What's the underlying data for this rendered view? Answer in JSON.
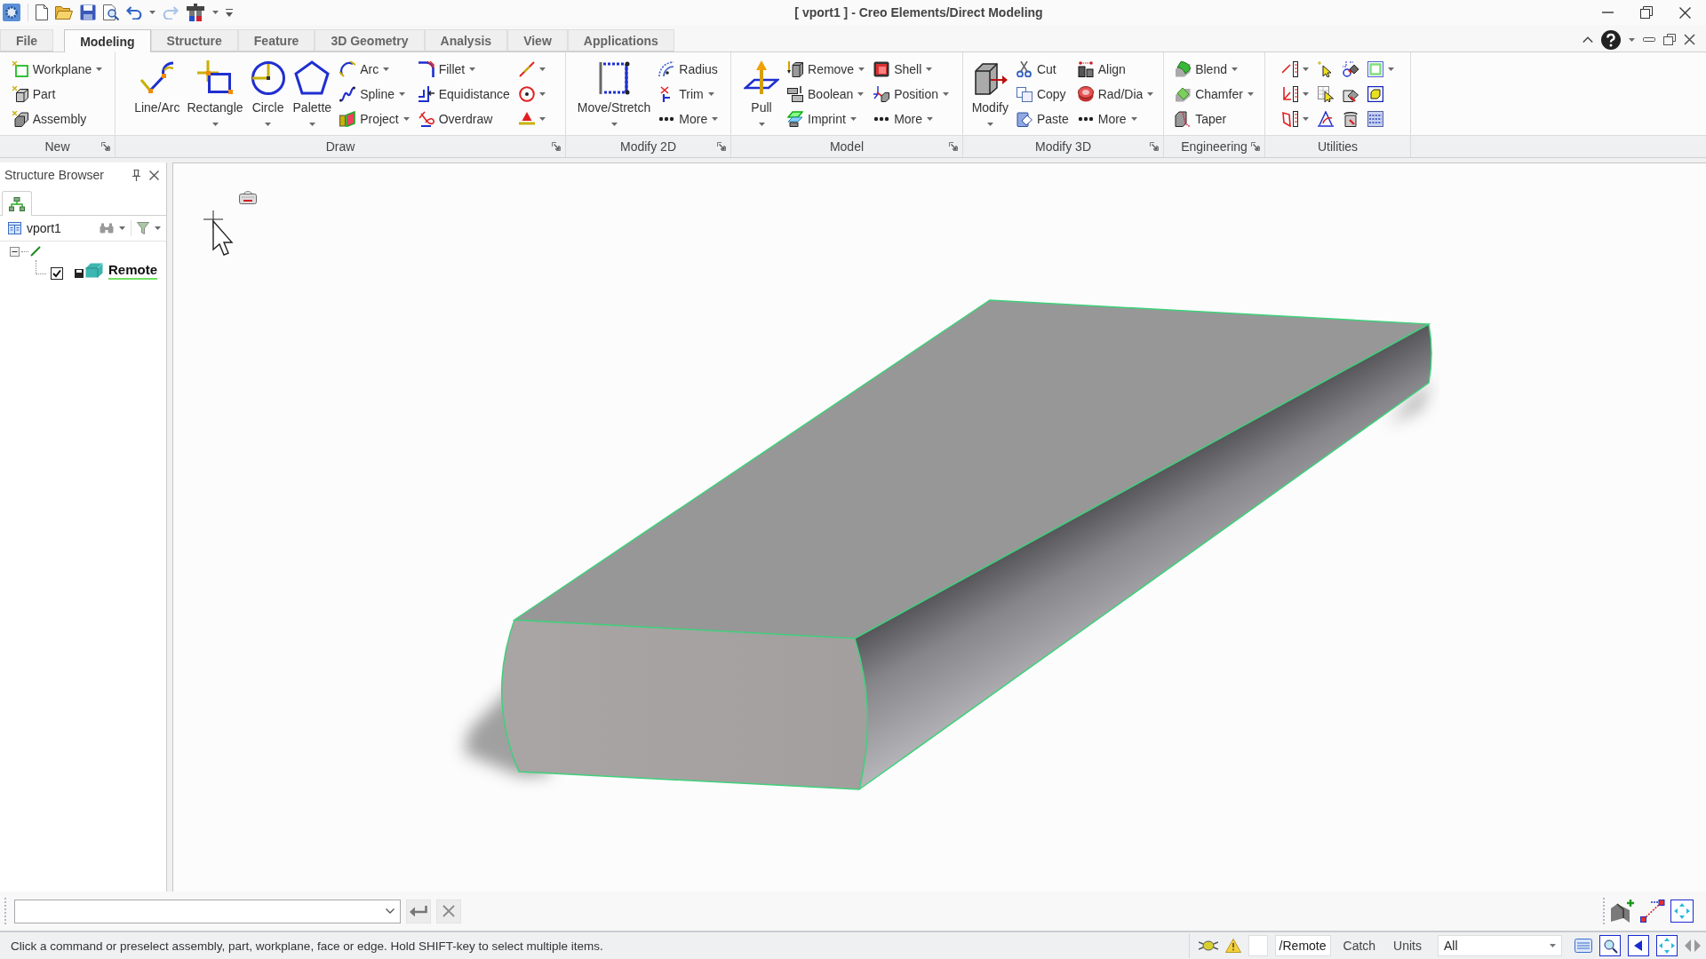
{
  "window": {
    "title": "[ vport1 ] - Creo Elements/Direct Modeling"
  },
  "tabs": [
    {
      "label": "File",
      "selected": false
    },
    {
      "label": "Modeling",
      "selected": true
    },
    {
      "label": "Structure",
      "selected": false
    },
    {
      "label": "Feature",
      "selected": false
    },
    {
      "label": "3D Geometry",
      "selected": false
    },
    {
      "label": "Analysis",
      "selected": false
    },
    {
      "label": "View",
      "selected": false
    },
    {
      "label": "Applications",
      "selected": false
    }
  ],
  "ribbon": {
    "groups": [
      {
        "label": "New",
        "launcher": true,
        "columns": [
          [
            {
              "kind": "small",
              "label": "Workplane",
              "dropdown": true
            },
            {
              "kind": "small",
              "label": "Part",
              "dropdown": false
            },
            {
              "kind": "small",
              "label": "Assembly",
              "dropdown": false
            }
          ]
        ]
      },
      {
        "label": "Draw",
        "launcher": true,
        "columns": [
          [
            {
              "kind": "large",
              "label": "Line/Arc",
              "dropdown": false
            }
          ],
          [
            {
              "kind": "large",
              "label": "Rectangle",
              "dropdown": true
            }
          ],
          [
            {
              "kind": "large",
              "label": "Circle",
              "dropdown": true
            }
          ],
          [
            {
              "kind": "large",
              "label": "Palette",
              "dropdown": true
            }
          ],
          [
            {
              "kind": "small",
              "label": "Arc",
              "dropdown": true
            },
            {
              "kind": "small",
              "label": "Spline",
              "dropdown": true
            },
            {
              "kind": "small",
              "label": "Project",
              "dropdown": true
            }
          ],
          [
            {
              "kind": "small",
              "label": "Fillet",
              "dropdown": true
            },
            {
              "kind": "small",
              "label": "Equidistance",
              "dropdown": false
            },
            {
              "kind": "small",
              "label": "Overdraw",
              "dropdown": false
            }
          ],
          [
            {
              "kind": "icon",
              "dropdown": true
            },
            {
              "kind": "icon",
              "dropdown": true
            },
            {
              "kind": "icon",
              "dropdown": true
            }
          ]
        ]
      },
      {
        "label": "Modify 2D",
        "launcher": true,
        "columns": [
          [
            {
              "kind": "large",
              "label": "Move/Stretch",
              "dropdown": true
            }
          ],
          [
            {
              "kind": "small",
              "label": "Radius",
              "dropdown": false
            },
            {
              "kind": "small",
              "label": "Trim",
              "dropdown": true
            },
            {
              "kind": "small",
              "label": "More",
              "dropdown": true
            }
          ]
        ]
      },
      {
        "label": "Model",
        "launcher": true,
        "columns": [
          [
            {
              "kind": "large",
              "label": "Pull",
              "dropdown": true
            }
          ],
          [
            {
              "kind": "small",
              "label": "Remove",
              "dropdown": true
            },
            {
              "kind": "small",
              "label": "Boolean",
              "dropdown": true
            },
            {
              "kind": "small",
              "label": "Imprint",
              "dropdown": true
            }
          ],
          [
            {
              "kind": "small",
              "label": "Shell",
              "dropdown": true
            },
            {
              "kind": "small",
              "label": "Position",
              "dropdown": true
            },
            {
              "kind": "small",
              "label": "More",
              "dropdown": true
            }
          ]
        ]
      },
      {
        "label": "Modify 3D",
        "launcher": true,
        "columns": [
          [
            {
              "kind": "large",
              "label": "Modify",
              "dropdown": true
            }
          ],
          [
            {
              "kind": "small",
              "label": "Cut",
              "dropdown": false
            },
            {
              "kind": "small",
              "label": "Copy",
              "dropdown": false
            },
            {
              "kind": "small",
              "label": "Paste",
              "dropdown": false
            }
          ],
          [
            {
              "kind": "small",
              "label": "Align",
              "dropdown": false
            },
            {
              "kind": "small",
              "label": "Rad/Dia",
              "dropdown": true
            },
            {
              "kind": "small",
              "label": "More",
              "dropdown": true
            }
          ]
        ]
      },
      {
        "label": "Engineering",
        "launcher": true,
        "columns": [
          [
            {
              "kind": "small",
              "label": "Blend",
              "dropdown": true
            },
            {
              "kind": "small",
              "label": "Chamfer",
              "dropdown": true
            },
            {
              "kind": "small",
              "label": "Taper",
              "dropdown": false
            }
          ]
        ]
      },
      {
        "label": "Utilities",
        "launcher": false,
        "columns": [
          [
            {
              "kind": "icon",
              "dropdown": true
            },
            {
              "kind": "icon",
              "dropdown": true
            },
            {
              "kind": "icon",
              "dropdown": true
            }
          ],
          [
            {
              "kind": "icon",
              "dropdown": false
            },
            {
              "kind": "icon",
              "dropdown": false
            },
            {
              "kind": "icon",
              "dropdown": false
            }
          ],
          [
            {
              "kind": "icon",
              "dropdown": false
            },
            {
              "kind": "icon",
              "dropdown": false
            },
            {
              "kind": "icon",
              "dropdown": false
            }
          ],
          [
            {
              "kind": "icon",
              "dropdown": true
            },
            {
              "kind": "icon",
              "dropdown": false
            },
            {
              "kind": "icon",
              "dropdown": false
            }
          ]
        ]
      }
    ]
  },
  "structure_browser": {
    "title": "Structure Browser",
    "root": "vport1",
    "tree": [
      {
        "expanded": true,
        "children": [
          {
            "label": "Remote",
            "checked": true,
            "active": true
          }
        ]
      }
    ]
  },
  "status_bar": {
    "message": "Click a command or preselect assembly, part, workplane, face or edge. Hold SHIFT-key to select multiple items.",
    "part_path": "/Remote",
    "buttons": [
      "Catch",
      "Units"
    ],
    "filter": "All"
  }
}
